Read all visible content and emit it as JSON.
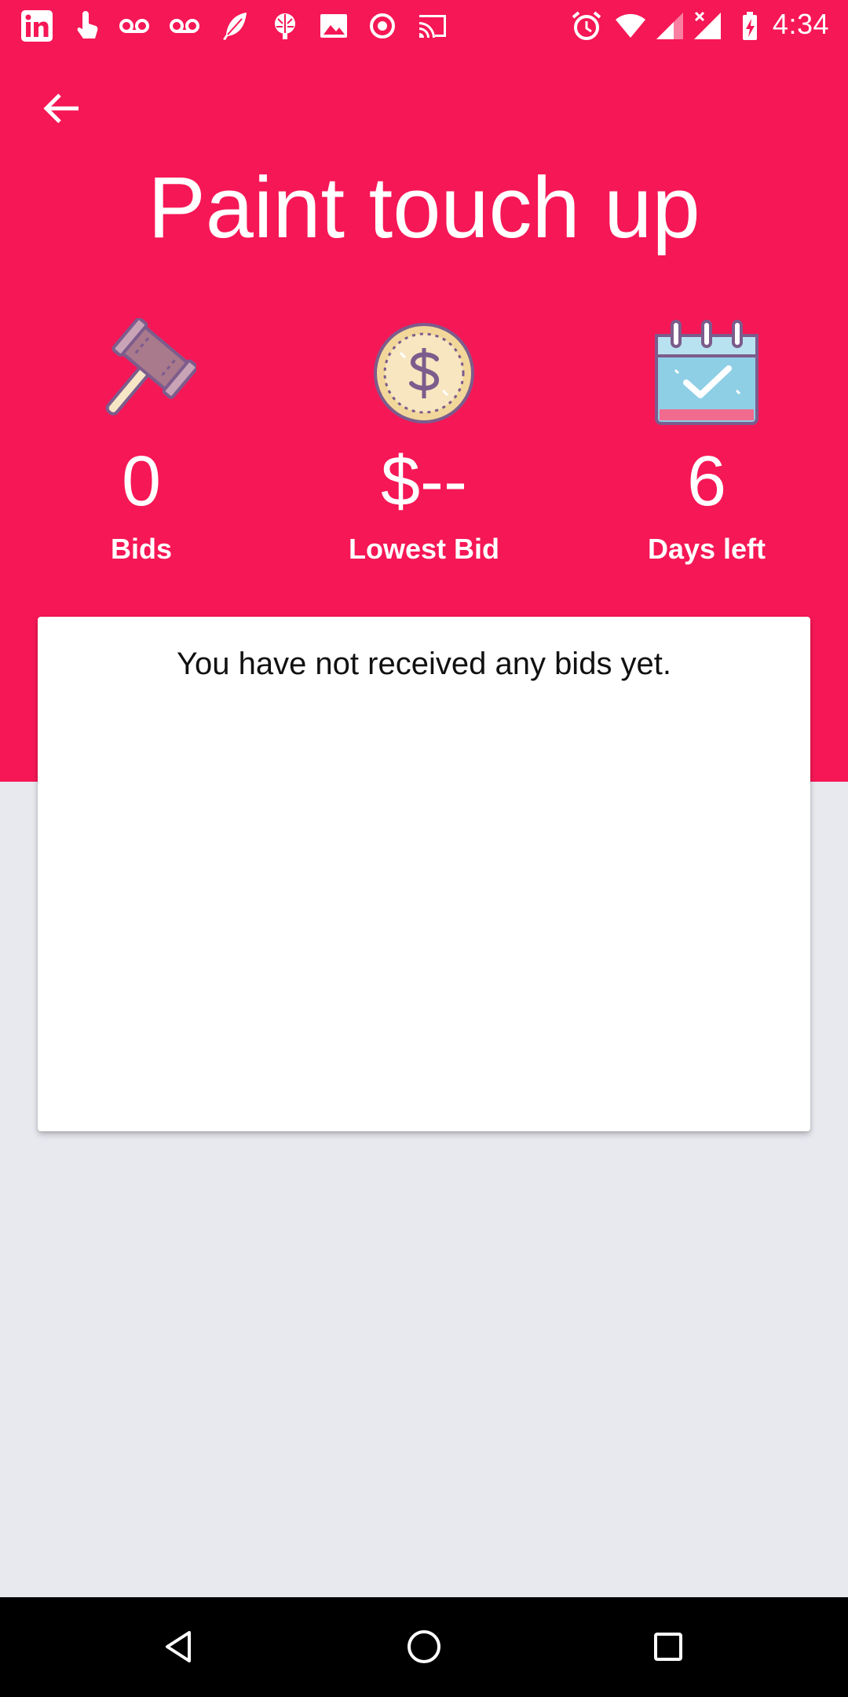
{
  "status_bar": {
    "time": "4:34",
    "left_icons": [
      "linkedin-icon",
      "touch-icon",
      "voicemail-icon",
      "voicemail-icon",
      "feather-icon",
      "brain-icon",
      "image-icon",
      "record-icon",
      "cast-icon"
    ],
    "right_icons": [
      "alarm-icon",
      "wifi-icon",
      "signal-icon",
      "signal-x-icon",
      "battery-charging-icon"
    ]
  },
  "header": {
    "title": "Paint touch up",
    "background_color": "#F61756"
  },
  "stats": [
    {
      "icon": "gavel-icon",
      "value": "0",
      "label": "Bids"
    },
    {
      "icon": "coin-icon",
      "value": "$--",
      "label": "Lowest Bid"
    },
    {
      "icon": "calendar-check-icon",
      "value": "6",
      "label": "Days left"
    }
  ],
  "bids_card": {
    "message": "You have not received any bids yet."
  },
  "nav_bar": {
    "buttons": [
      "back-icon",
      "home-icon",
      "recents-icon"
    ]
  }
}
